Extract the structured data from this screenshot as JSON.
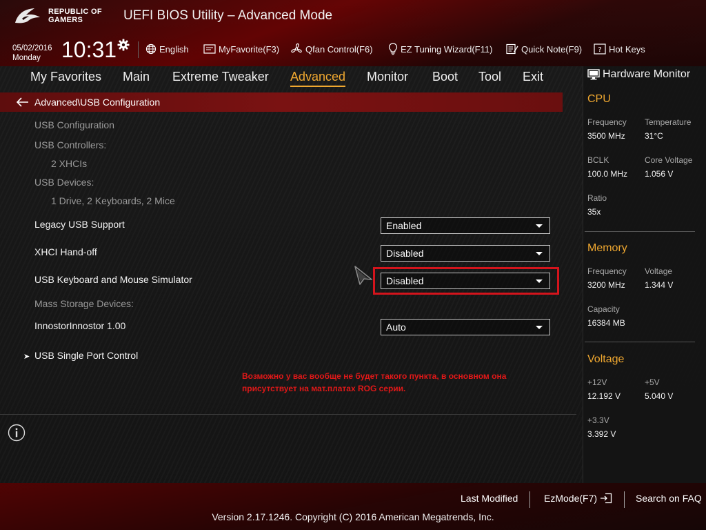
{
  "header": {
    "brand_line1": "REPUBLIC OF",
    "brand_line2": "GAMERS",
    "title": "UEFI BIOS Utility – Advanced Mode",
    "date": "05/02/2016",
    "weekday": "Monday",
    "time": "10:31",
    "toolbar": [
      {
        "label": "English",
        "icon": "globe-icon"
      },
      {
        "label": "MyFavorite(F3)",
        "icon": "favorite-icon"
      },
      {
        "label": "Qfan Control(F6)",
        "icon": "fan-icon"
      },
      {
        "label": "EZ Tuning Wizard(F11)",
        "icon": "bulb-icon"
      },
      {
        "label": "Quick Note(F9)",
        "icon": "note-icon"
      },
      {
        "label": "Hot Keys",
        "icon": "hotkeys-icon"
      }
    ]
  },
  "nav": {
    "tabs": [
      {
        "label": "My Favorites"
      },
      {
        "label": "Main"
      },
      {
        "label": "Extreme Tweaker"
      },
      {
        "label": "Advanced",
        "active": true
      },
      {
        "label": "Monitor"
      },
      {
        "label": "Boot"
      },
      {
        "label": "Tool"
      },
      {
        "label": "Exit"
      }
    ]
  },
  "breadcrumb": {
    "path": "Advanced\\USB Configuration"
  },
  "settings": {
    "section_title": "USB Configuration",
    "controllers_label": "USB Controllers:",
    "controllers_value": "2 XHCIs",
    "devices_label": "USB Devices:",
    "devices_value": "1 Drive, 2 Keyboards, 2 Mice",
    "legacy_usb": {
      "label": "Legacy USB Support",
      "value": "Enabled"
    },
    "xhci_handoff": {
      "label": "XHCI Hand-off",
      "value": "Disabled"
    },
    "kb_mouse_sim": {
      "label": "USB Keyboard and Mouse Simulator",
      "value": "Disabled"
    },
    "mass_storage_label": "Mass Storage Devices:",
    "innostor": {
      "label": "InnostorInnostor 1.00",
      "value": "Auto"
    },
    "single_port": {
      "label": "USB Single Port Control"
    }
  },
  "annotation": {
    "line1": "Возможно у вас вообще не будет такого пункта, в основном она",
    "line2": "присутствует на мат.платах ROG серии."
  },
  "hardware_monitor": {
    "title": "Hardware Monitor",
    "cpu": {
      "title": "CPU",
      "frequency_label": "Frequency",
      "frequency": "3500 MHz",
      "temperature_label": "Temperature",
      "temperature": "31°C",
      "bclk_label": "BCLK",
      "bclk": "100.0 MHz",
      "core_voltage_label": "Core Voltage",
      "core_voltage": "1.056 V",
      "ratio_label": "Ratio",
      "ratio": "35x"
    },
    "memory": {
      "title": "Memory",
      "frequency_label": "Frequency",
      "frequency": "3200 MHz",
      "voltage_label": "Voltage",
      "voltage": "1.344 V",
      "capacity_label": "Capacity",
      "capacity": "16384 MB"
    },
    "voltage": {
      "title": "Voltage",
      "v12_label": "+12V",
      "v12": "12.192 V",
      "v5_label": "+5V",
      "v5": "5.040 V",
      "v33_label": "+3.3V",
      "v33": "3.392 V"
    }
  },
  "footer": {
    "last_modified": "Last Modified",
    "ezmode": "EzMode(F7)",
    "search_faq": "Search on FAQ",
    "copyright": "Version 2.17.1246. Copyright (C) 2016 American Megatrends, Inc."
  },
  "colors": {
    "accent": "#f0a830",
    "highlight": "#d4141c",
    "annotation": "#e01818"
  }
}
